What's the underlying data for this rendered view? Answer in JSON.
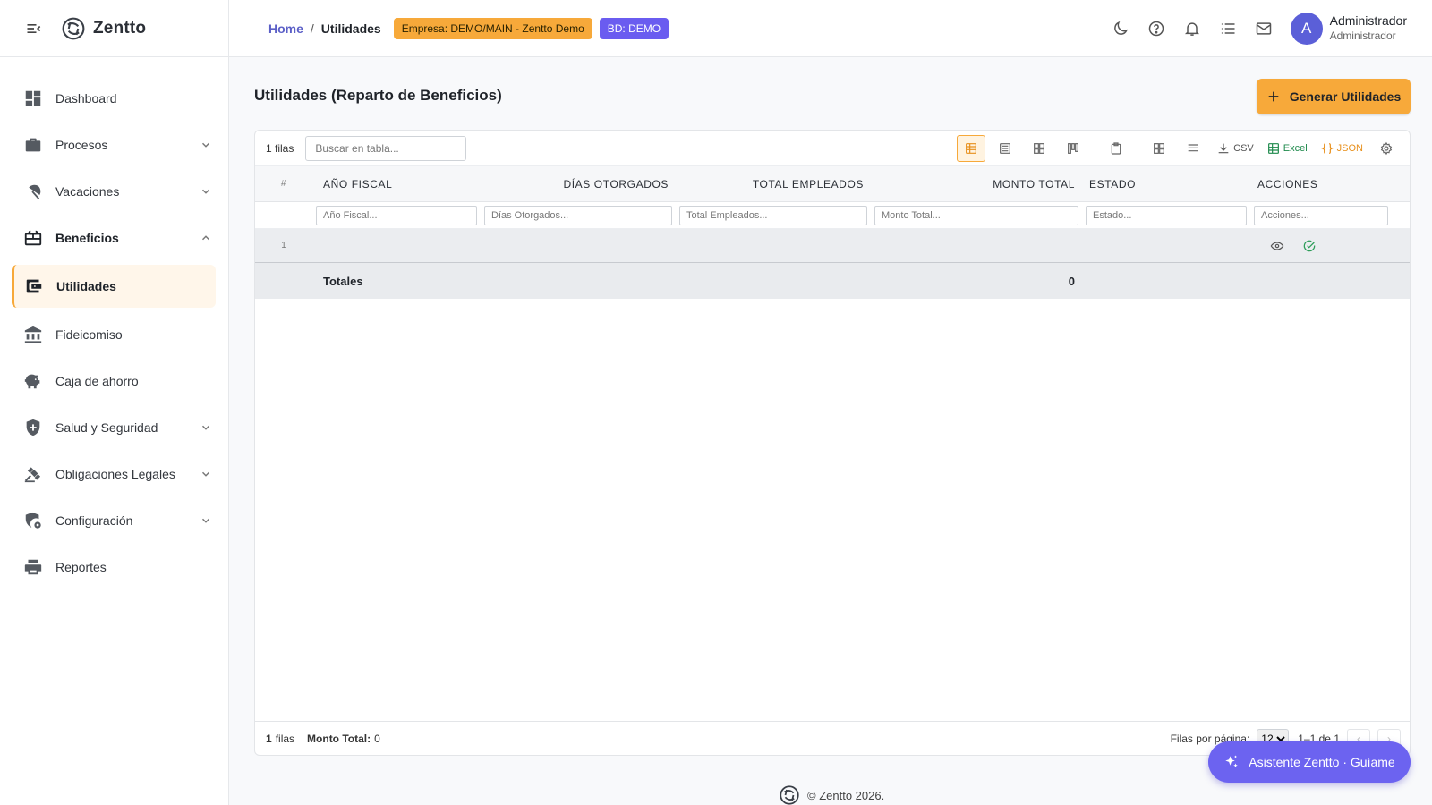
{
  "app": {
    "name": "Zentto"
  },
  "sidebar": {
    "items": [
      {
        "label": "Dashboard"
      },
      {
        "label": "Procesos"
      },
      {
        "label": "Vacaciones"
      },
      {
        "label": "Beneficios"
      },
      {
        "label": "Utilidades"
      },
      {
        "label": "Fideicomiso"
      },
      {
        "label": "Caja de ahorro"
      },
      {
        "label": "Salud y Seguridad"
      },
      {
        "label": "Obligaciones Legales"
      },
      {
        "label": "Configuración"
      },
      {
        "label": "Reportes"
      }
    ]
  },
  "topbar": {
    "breadcrumb_home": "Home",
    "breadcrumb_sep": "/",
    "breadcrumb_current": "Utilidades",
    "empresa_chip": "Empresa: DEMO/MAIN - Zentto Demo",
    "bd_chip": "BD: DEMO",
    "avatar_letter": "A",
    "user_name": "Administrador",
    "user_role": "Administrador",
    "icons": [
      "moon-icon",
      "help-icon",
      "bell-icon",
      "list-icon",
      "mail-icon"
    ]
  },
  "page": {
    "title": "Utilidades (Reparto de Beneficios)",
    "generate_button": "Generar Utilidades"
  },
  "table": {
    "row_count_label": "1 filas",
    "search_placeholder": "Buscar en tabla...",
    "export_csv": "CSV",
    "export_excel": "Excel",
    "export_json": "JSON",
    "columns": {
      "idx": "#",
      "anio": "AÑO FISCAL",
      "dias": "DÍAS OTORGADOS",
      "empleados": "TOTAL EMPLEADOS",
      "monto": "MONTO TOTAL",
      "estado": "ESTADO",
      "acciones": "ACCIONES"
    },
    "filters": {
      "anio": "Año Fiscal...",
      "dias": "Días Otorgados...",
      "empleados": "Total Empleados...",
      "monto": "Monto Total...",
      "estado": "Estado...",
      "acciones": "Acciones..."
    },
    "rows": [
      {
        "idx": "1",
        "anio": "",
        "dias": "",
        "empleados": "",
        "monto": "",
        "estado": ""
      }
    ],
    "totals": {
      "label": "Totales",
      "monto": "0"
    },
    "footer": {
      "count_num": "1",
      "count_word": "filas",
      "monto_label": "Monto Total:",
      "monto_value": "0",
      "rows_per_page_label": "Filas por página:",
      "rows_per_page_value": "12",
      "range": "1–1 de 1",
      "prev": "‹",
      "next": "›"
    }
  },
  "assistant": {
    "label": "Asistente Zentto · Guíame"
  },
  "footer": {
    "copyright": "© Zentto 2026."
  },
  "colors": {
    "accent": "#f7a93a",
    "primary": "#6c63f0",
    "link": "#5b5fc7",
    "success": "#2e9d5a"
  }
}
